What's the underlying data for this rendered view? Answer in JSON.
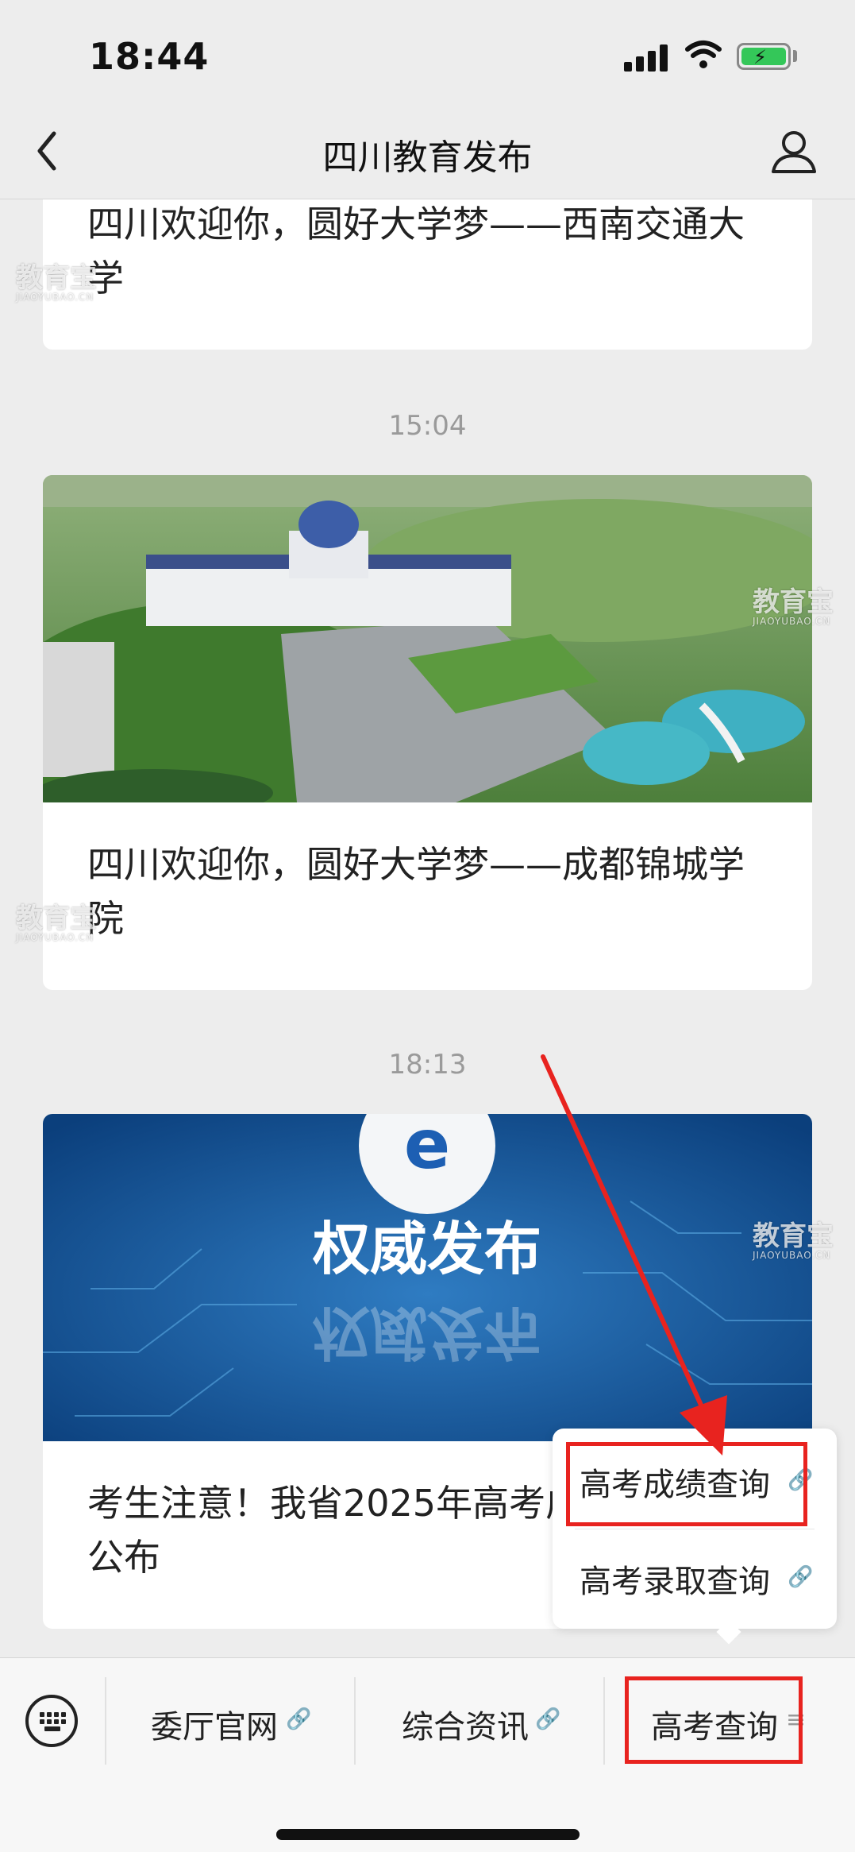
{
  "status_bar": {
    "time": "18:44"
  },
  "nav": {
    "title": "四川教育发布"
  },
  "feed": [
    {
      "title": "四川欢迎你，圆好大学梦——西南交通大学"
    },
    {
      "time": "15:04",
      "title": "四川欢迎你，圆好大学梦——成都锦城学院"
    },
    {
      "time": "18:13",
      "banner_text": "权威发布",
      "title": "考生注意！我省2025年高考成绩查询方式公布"
    }
  ],
  "popup": {
    "items": [
      {
        "label": "高考成绩查询",
        "icon": "link-icon"
      },
      {
        "label": "高考录取查询",
        "icon": "link-icon"
      }
    ]
  },
  "menu": {
    "items": [
      {
        "label": "委厅官网",
        "icon": "link-icon"
      },
      {
        "label": "综合资讯",
        "icon": "link-icon"
      },
      {
        "label": "高考查询",
        "icon": "menu-lines-icon"
      }
    ]
  },
  "watermark": {
    "text": "教育宝",
    "sub": "JIAOYUBAO.CN"
  },
  "colors": {
    "annotation_red": "#e8231f",
    "battery_green": "#34c759"
  }
}
